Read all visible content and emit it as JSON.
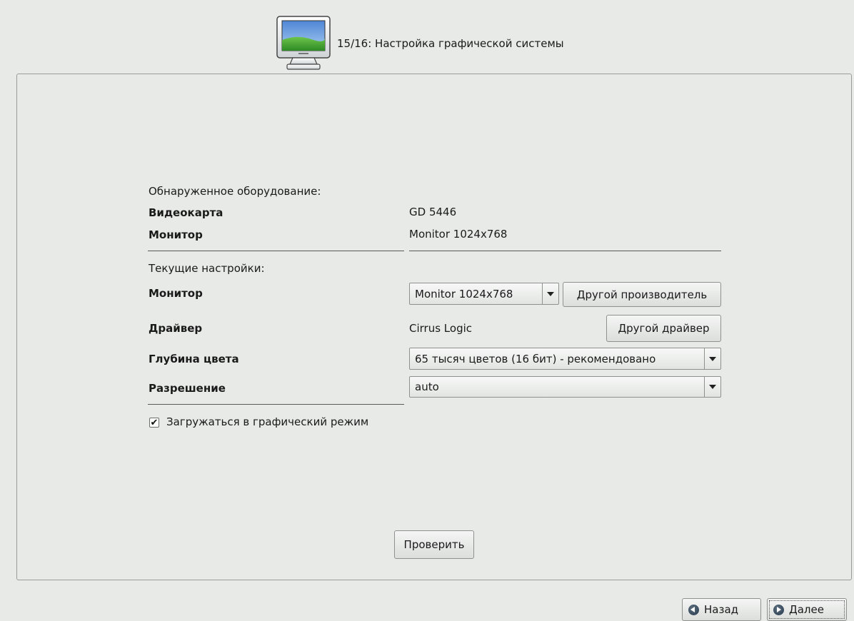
{
  "header": {
    "title": "15/16: Настройка графической системы",
    "icon": "monitor-icon"
  },
  "detected": {
    "heading": "Обнаруженное оборудование:",
    "videocard_label": "Видеокарта",
    "videocard_value": "GD 5446",
    "monitor_label": "Монитор",
    "monitor_value": "Monitor 1024x768"
  },
  "current": {
    "heading": "Текущие настройки:",
    "monitor_label": "Монитор",
    "monitor_value": "Monitor 1024x768",
    "other_vendor_button": "Другой производитель",
    "driver_label": "Драйвер",
    "driver_value": "Cirrus Logic",
    "other_driver_button": "Другой драйвер",
    "color_depth_label": "Глубина цвета",
    "color_depth_value": "65 тысяч цветов (16 бит) - рекомендовано",
    "resolution_label": "Разрешение",
    "resolution_value": "auto"
  },
  "boot_graphical": {
    "label": "Загружаться в графический режим",
    "checked": true
  },
  "test_button": "Проверить",
  "nav": {
    "back_label": "Назад",
    "next_label": "Далее"
  }
}
